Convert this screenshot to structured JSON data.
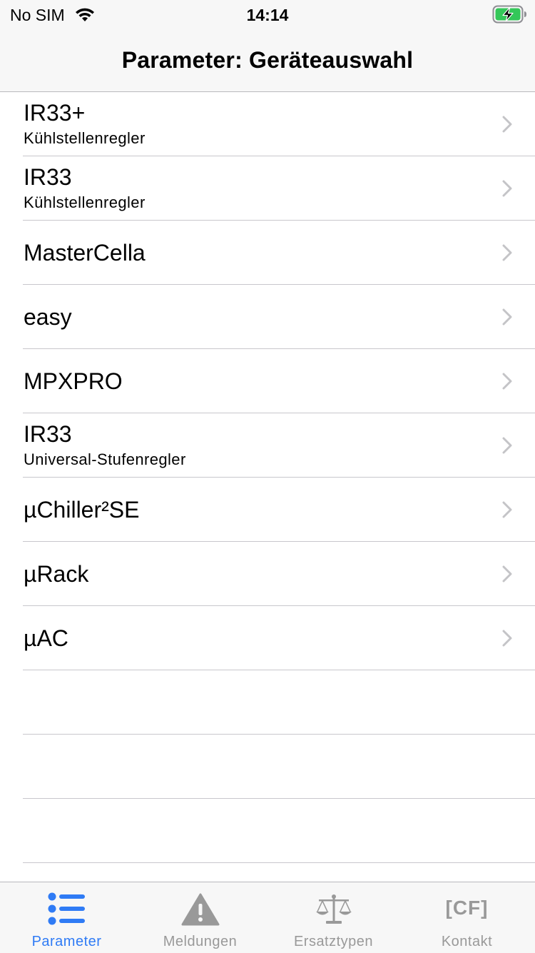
{
  "status_bar": {
    "carrier": "No SIM",
    "time": "14:14",
    "wifi_icon": "wifi-icon",
    "battery_icon": "battery-charging-icon",
    "battery_color": "#34c759"
  },
  "nav": {
    "title": "Parameter: Geräteauswahl"
  },
  "list": {
    "chevron_icon": "chevron-right-icon",
    "chevron_color": "#c4c4c7",
    "separator_color": "#c8c7cc",
    "items": [
      {
        "title": "IR33+",
        "subtitle": "Kühlstellenregler"
      },
      {
        "title": "IR33",
        "subtitle": "Kühlstellenregler"
      },
      {
        "title": "MasterCella",
        "subtitle": ""
      },
      {
        "title": "easy",
        "subtitle": ""
      },
      {
        "title": "MPXPRO",
        "subtitle": ""
      },
      {
        "title": "IR33",
        "subtitle": "Universal-Stufenregler"
      },
      {
        "title": "µChiller²SE",
        "subtitle": ""
      },
      {
        "title": "µRack",
        "subtitle": ""
      },
      {
        "title": "µAC",
        "subtitle": ""
      }
    ]
  },
  "tabbar": {
    "active_color": "#2f7bf5",
    "inactive_color": "#999999",
    "tabs": [
      {
        "label": "Parameter",
        "icon": "list-icon",
        "active": true
      },
      {
        "label": "Meldungen",
        "icon": "warning-icon",
        "active": false
      },
      {
        "label": "Ersatztypen",
        "icon": "scales-icon",
        "active": false
      },
      {
        "label": "Kontakt",
        "icon": "cf-logo-icon",
        "icon_text": "[CF]",
        "active": false
      }
    ]
  }
}
